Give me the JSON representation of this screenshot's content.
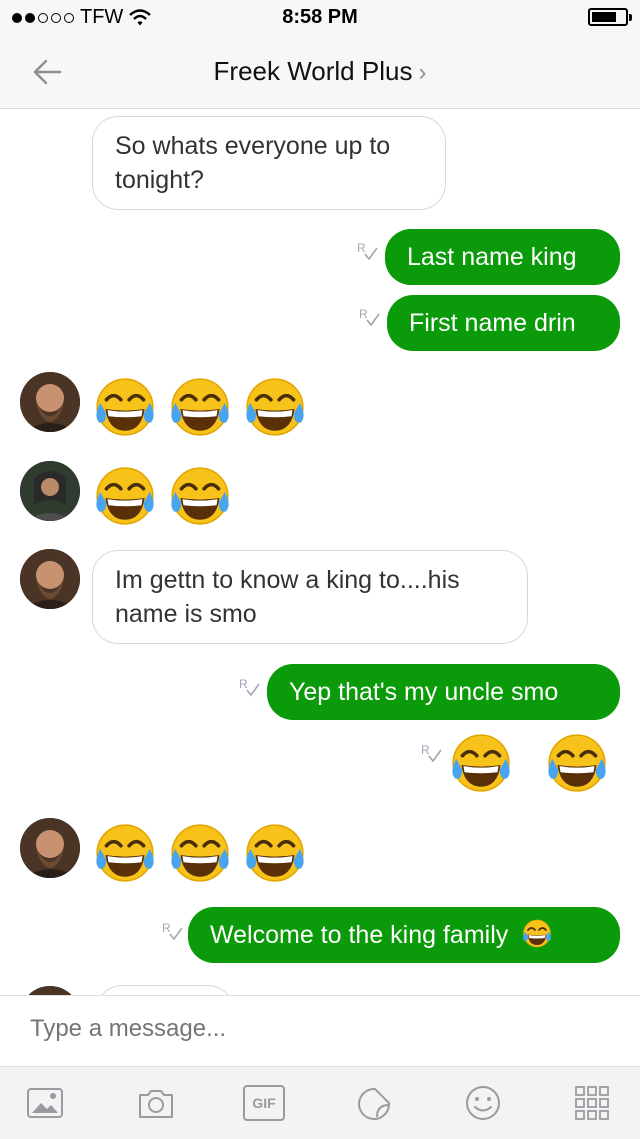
{
  "status_bar": {
    "carrier": "TFW",
    "time": "8:58 PM"
  },
  "header": {
    "title": "Freek World Plus",
    "chevron": "›"
  },
  "messages": {
    "m1": "So whats everyone up to tonight?",
    "m2": "Last name king",
    "m3": "First name drin",
    "m6": "Im gettn to know a king to....his name is smo",
    "m7": "Yep that's my uncle smo",
    "m10": "Welcome to the king family"
  },
  "emoji_rows": [
    {
      "sender": "incoming",
      "emoji": "face-with-tears-of-joy",
      "count": 3
    },
    {
      "sender": "incoming",
      "emoji": "face-with-tears-of-joy",
      "count": 2
    },
    {
      "sender": "outgoing",
      "emoji": "face-with-tears-of-joy",
      "count": 2
    },
    {
      "sender": "incoming",
      "emoji": "face-with-tears-of-joy",
      "count": 3
    }
  ],
  "receipt_symbol": "R",
  "composer": {
    "placeholder": "Type a message..."
  },
  "toolbar": {
    "gif_label": "GIF"
  },
  "icons": [
    "back-arrow-icon",
    "gallery-icon",
    "camera-icon",
    "gif-icon",
    "sticker-icon",
    "smiley-icon",
    "grid-icon"
  ],
  "colors": {
    "outgoing_bubble": "#0a9a0a",
    "incoming_border": "#d8d8d8",
    "bar_background": "#f7f7f7",
    "icon_gray": "#9a9aa0"
  }
}
